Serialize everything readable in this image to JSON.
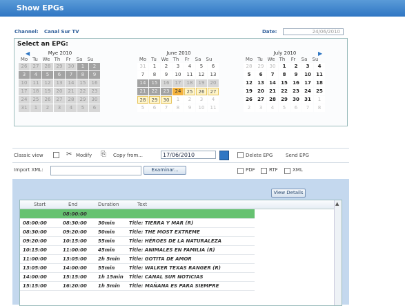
{
  "window": {
    "title": "Show EPGs"
  },
  "header": {
    "channel_label": "Channel:",
    "channel_value": "Canal Sur TV",
    "date_label": "Date:",
    "date_value": "24/06/2010"
  },
  "epg": {
    "title": "Select an EPG:",
    "calendars": [
      {
        "month": "Mye 2010",
        "prev_icon": "chevron-left-icon"
      },
      {
        "month": "June 2010"
      },
      {
        "month": "July 2010",
        "next_icon": "chevron-right-icon"
      }
    ],
    "dow": [
      "Mo",
      "Tu",
      "We",
      "Th",
      "Fr",
      "Sa",
      "Su"
    ],
    "may_weeks": [
      [
        "26",
        "27",
        "28",
        "29",
        "30",
        "1",
        "2"
      ],
      [
        "3",
        "4",
        "5",
        "6",
        "7",
        "8",
        "9"
      ],
      [
        "10",
        "11",
        "12",
        "13",
        "14",
        "15",
        "16"
      ],
      [
        "17",
        "18",
        "19",
        "20",
        "21",
        "22",
        "23"
      ],
      [
        "24",
        "25",
        "26",
        "27",
        "28",
        "29",
        "30"
      ],
      [
        "31",
        "1",
        "2",
        "3",
        "4",
        "5",
        "6"
      ]
    ],
    "june_weeks": [
      [
        "31",
        "1",
        "2",
        "3",
        "4",
        "5",
        "6"
      ],
      [
        "7",
        "8",
        "9",
        "10",
        "11",
        "12",
        "13"
      ],
      [
        "14",
        "15",
        "16",
        "17",
        "18",
        "19",
        "20"
      ],
      [
        "21",
        "22",
        "23",
        "24",
        "25",
        "26",
        "27"
      ],
      [
        "28",
        "29",
        "30",
        "1",
        "2",
        "3",
        "4"
      ],
      [
        "5",
        "6",
        "7",
        "8",
        "9",
        "10",
        "11"
      ]
    ],
    "july_weeks": [
      [
        "28",
        "29",
        "30",
        "1",
        "2",
        "3",
        "4"
      ],
      [
        "5",
        "6",
        "7",
        "8",
        "9",
        "10",
        "11"
      ],
      [
        "12",
        "13",
        "14",
        "15",
        "16",
        "17",
        "18"
      ],
      [
        "19",
        "20",
        "21",
        "22",
        "23",
        "24",
        "25"
      ],
      [
        "26",
        "27",
        "28",
        "29",
        "30",
        "31",
        "1"
      ],
      [
        "2",
        "3",
        "4",
        "5",
        "6",
        "7",
        "8"
      ]
    ]
  },
  "toolbar": {
    "classic_view": "Classic view",
    "modify": "Modify",
    "copy_from": "Copy from...",
    "date_input": "17/06/2010",
    "delete_epg": "Delete EPG",
    "send_epg": "Send EPG"
  },
  "import": {
    "label": "Import XML:",
    "browse": "Examinar...",
    "pdf": "PDF",
    "rtf": "RTF",
    "xml": "XML"
  },
  "grid": {
    "view_details": "View Details",
    "columns": [
      "Start",
      "End",
      "Duration",
      "Text"
    ],
    "rows": [
      {
        "start": "",
        "end": "08:00:00",
        "duration": "",
        "text": ""
      },
      {
        "start": "08:00:00",
        "end": "08:30:00",
        "duration": "30min",
        "text": "Title: TIERRA Y MAR (R)"
      },
      {
        "start": "08:30:00",
        "end": "09:20:00",
        "duration": "50min",
        "text": "Title: THE MOST EXTREME"
      },
      {
        "start": "09:20:00",
        "end": "10:15:00",
        "duration": "55min",
        "text": "Title: HÉROES DE LA NATURALEZA"
      },
      {
        "start": "10:15:00",
        "end": "11:00:00",
        "duration": "45min",
        "text": "Title: ANIMALES EN FAMILIA (R)"
      },
      {
        "start": "11:00:00",
        "end": "13:05:00",
        "duration": "2h 5min",
        "text": "Title: GOTITA DE AMOR"
      },
      {
        "start": "13:05:00",
        "end": "14:00:00",
        "duration": "55min",
        "text": "Title: WALKER TEXAS RANGER (R)"
      },
      {
        "start": "14:00:00",
        "end": "15:15:00",
        "duration": "1h 15min",
        "text": "Title: CANAL SUR NOTICIAS"
      },
      {
        "start": "15:15:00",
        "end": "16:20:00",
        "duration": "1h 5min",
        "text": "Title: MAÑANA ES PARA SIEMPRE"
      }
    ]
  }
}
